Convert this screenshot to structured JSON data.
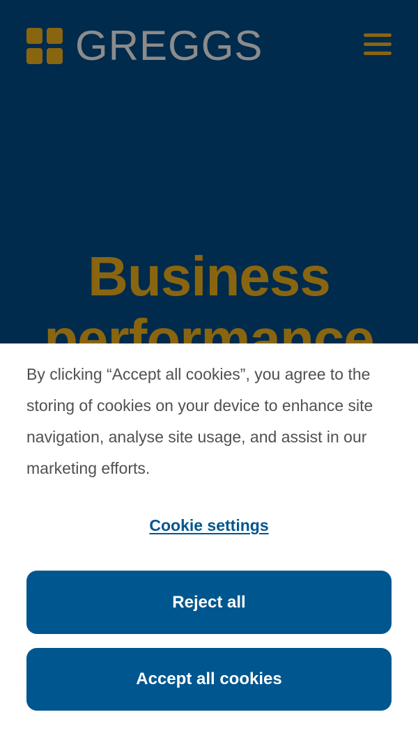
{
  "header": {
    "logo_text": "GREGGS",
    "menu_icon": "hamburger-menu-icon"
  },
  "hero": {
    "title": "Business performance"
  },
  "cookie_banner": {
    "message": "By clicking “Accept all cookies”, you agree to the storing of cookies on your device to enhance site navigation, analyse site usage, and assist in our marketing efforts.",
    "settings_link": "Cookie settings",
    "reject_label": "Reject all",
    "accept_label": "Accept all cookies"
  },
  "colors": {
    "background": "#012b4c",
    "brand_gold": "#8a6510",
    "logo_grey": "#8c8c8c",
    "button_blue": "#00568f",
    "text_grey": "#505050"
  }
}
